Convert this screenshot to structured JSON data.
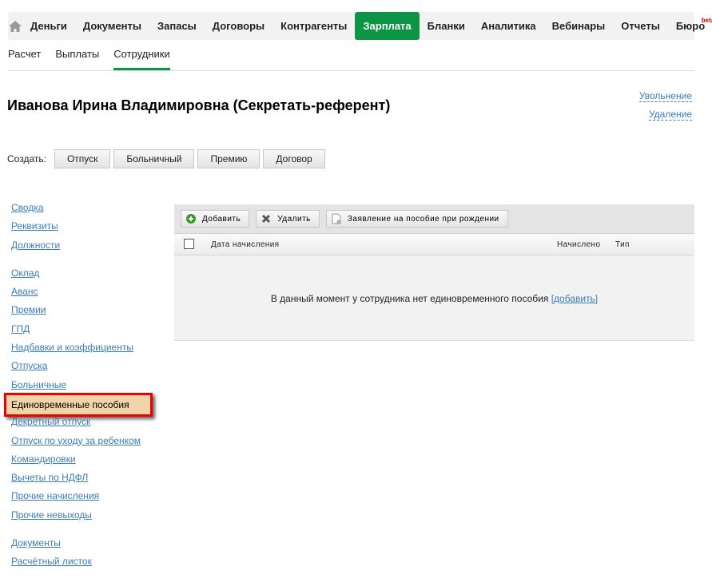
{
  "topnav": {
    "items": [
      "Деньги",
      "Документы",
      "Запасы",
      "Договоры",
      "Контрагенты",
      "Зарплата",
      "Бланки",
      "Аналитика",
      "Вебинары",
      "Отчеты",
      "Бюро"
    ],
    "beta": "beta",
    "active": "Зарплата",
    "accent": "#0c9544"
  },
  "subnav": [
    "Расчет",
    "Выплаты",
    "Сотрудники"
  ],
  "title": "Иванова Ирина Владимировна (Секретать-референт)",
  "actions": {
    "dismiss": "Увольнение",
    "delete": "Удаление"
  },
  "create": {
    "label": "Создать:",
    "buttons": [
      "Отпуск",
      "Больничный",
      "Премию",
      "Договор"
    ]
  },
  "sidebar": {
    "group1": [
      "Сводка",
      "Реквизиты",
      "Должности"
    ],
    "group2": [
      "Оклад",
      "Аванс",
      "Премии",
      "ГПД",
      "Надбавки и коэффициенты",
      "Отпуска",
      "Больничные"
    ],
    "selected": "Единовременные пособия",
    "group3": [
      "Декретный отпуск",
      "Отпуск по уходу за ребенком",
      "Командировки",
      "Вычеты по НДФЛ",
      "Прочие начисления",
      "Прочие невыходы"
    ],
    "group4": [
      "Документы",
      "Расчётный листок"
    ]
  },
  "toolbar": {
    "add": "Добавить",
    "remove": "Удалить",
    "statement": "Заявление на пособие при рождении"
  },
  "table": {
    "columns": [
      "Дата начисления",
      "Начислено",
      "Тип"
    ],
    "empty": "В данный момент у сотрудника нет единовременного пособия",
    "empty_link": "[добавить]"
  }
}
